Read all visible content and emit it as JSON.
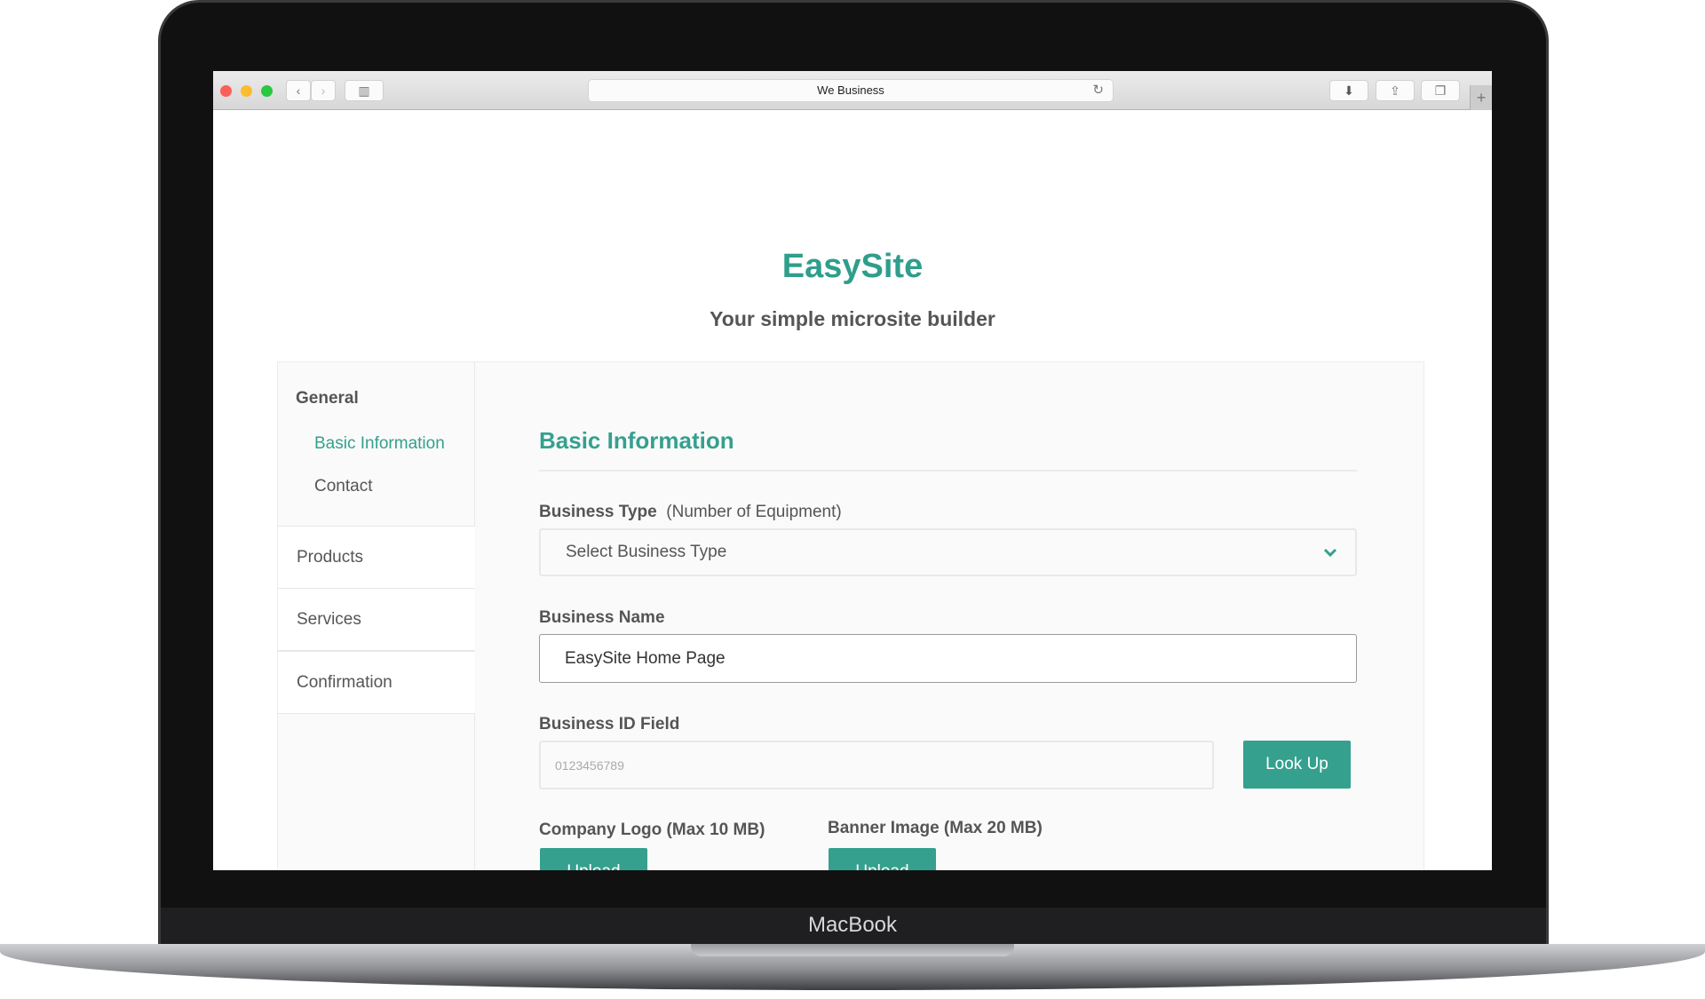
{
  "browser": {
    "url_title": "We Business",
    "device_label": "MacBook"
  },
  "colors": {
    "accent": "#35a08e",
    "title": "#2f9e8c"
  },
  "page": {
    "title": "EasySite",
    "subtitle": "Your simple microsite builder"
  },
  "sidebar": {
    "group": "General",
    "sub_items": [
      {
        "label": "Basic Information",
        "active": true
      },
      {
        "label": "Contact"
      }
    ],
    "items": [
      {
        "label": "Products"
      },
      {
        "label": "Services"
      },
      {
        "label": "Confirmation"
      }
    ]
  },
  "form": {
    "heading": "Basic Information",
    "business_type": {
      "label": "Business Type",
      "hint": "(Number of Equipment)",
      "placeholder": "Select Business Type"
    },
    "business_name": {
      "label": "Business Name",
      "value": "EasySite Home Page"
    },
    "business_id": {
      "label": "Business ID Field",
      "placeholder": "0123456789",
      "button": "Look Up"
    },
    "company_logo": {
      "label": "Company Logo (Max 10 MB)",
      "button": "Upload"
    },
    "banner_image": {
      "label": "Banner Image (Max 20 MB)",
      "button": "Upload"
    }
  }
}
